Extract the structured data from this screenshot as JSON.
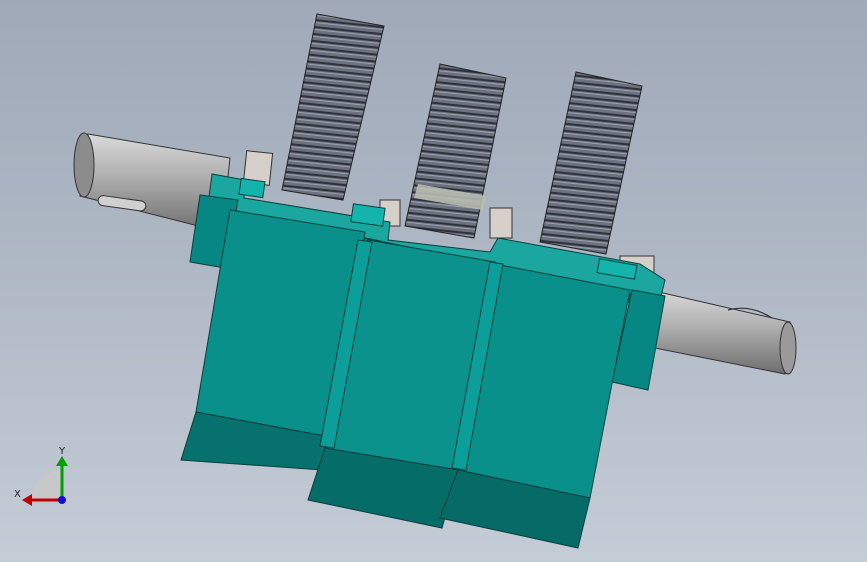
{
  "viewport": {
    "background_top": "#9fa9b8",
    "background_bottom": "#c4ccd6"
  },
  "model": {
    "housing_color": "#0b8f8a",
    "housing_dark": "#07716d",
    "housing_light": "#1bb0a9",
    "shaft_color": "#a6a6a6",
    "gear_color": "#5a5f6d",
    "gears": [
      "gear-1",
      "gear-2",
      "gear-3"
    ]
  },
  "triad": {
    "x_label": "X",
    "y_label": "Y",
    "x_color": "#c00000",
    "y_color": "#00a000",
    "z_color": "#1010d0"
  }
}
